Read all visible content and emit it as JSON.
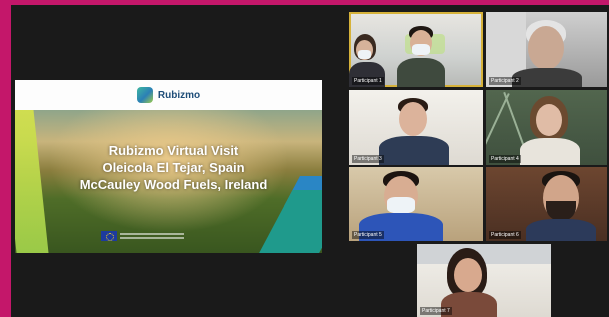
{
  "presentation": {
    "logo_text": "Rubizmo",
    "title_line1": "Rubizmo Virtual Visit",
    "title_line2": "Oleicola El Tejar, Spain",
    "title_line3": "McCauley Wood Fuels, Ireland",
    "colors": {
      "frame": "#c4176a",
      "background": "#1a1a1a",
      "active_speaker": "#d6b23a"
    }
  },
  "participants": [
    {
      "name": "Participant 1"
    },
    {
      "name": "Participant 2"
    },
    {
      "name": "Participant 3"
    },
    {
      "name": "Participant 4"
    },
    {
      "name": "Participant 5"
    },
    {
      "name": "Participant 6"
    },
    {
      "name": "Participant 7"
    }
  ]
}
